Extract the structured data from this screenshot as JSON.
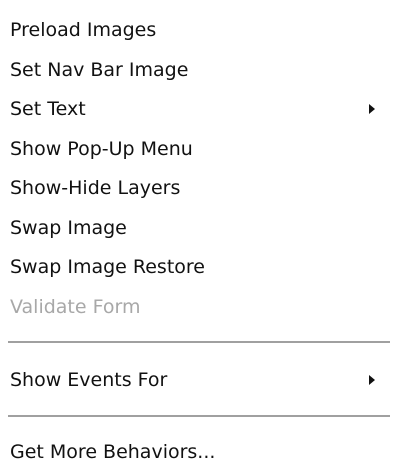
{
  "menu": {
    "items": [
      {
        "label": "Preload Images"
      },
      {
        "label": "Set Nav Bar Image"
      },
      {
        "label": "Set Text",
        "submenu": true
      },
      {
        "label": "Show Pop-Up Menu"
      },
      {
        "label": "Show-Hide Layers"
      },
      {
        "label": "Swap Image"
      },
      {
        "label": "Swap Image Restore"
      },
      {
        "label": "Validate Form",
        "disabled": true
      }
    ],
    "show_events": {
      "label": "Show Events For",
      "submenu": true
    },
    "get_more": {
      "label": "Get More Behaviors..."
    }
  },
  "colors": {
    "text": "#111111",
    "disabled_text": "#a8a8a8",
    "separator": "#a0a0a0",
    "background": "#ffffff"
  },
  "icons": {
    "submenu_arrow": "chevron-right-icon"
  }
}
